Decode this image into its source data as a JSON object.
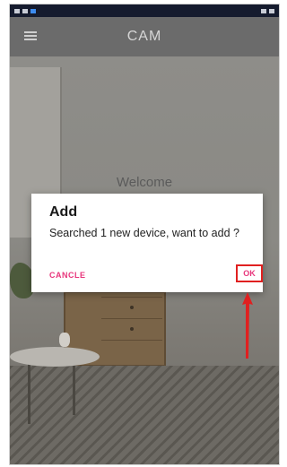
{
  "app": {
    "title": "CAM",
    "welcome_text": "Welcome"
  },
  "dialog": {
    "title": "Add",
    "message": "Searched 1 new device, want to add ?",
    "cancel_label": "CANCLE",
    "ok_label": "OK"
  },
  "colors": {
    "dialog_action": "#e8367c",
    "highlight": "#e02020",
    "status_bar": "#151b2e"
  },
  "icons": {
    "menu": "menu-icon",
    "arrow": "arrow-up-icon"
  }
}
